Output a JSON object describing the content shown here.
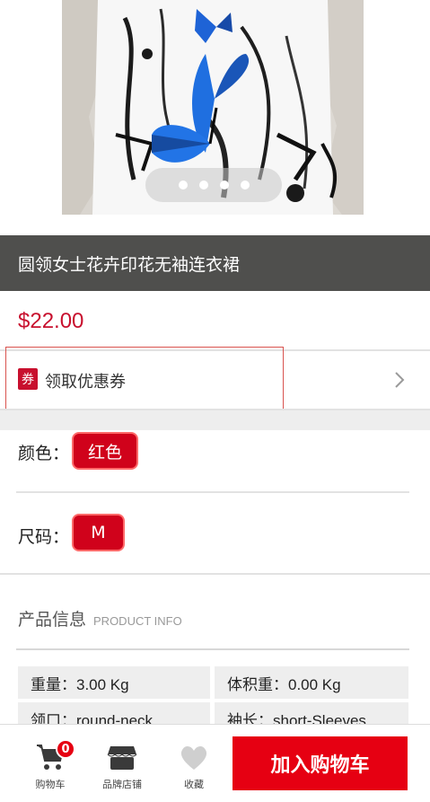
{
  "product": {
    "title": "圆领女士花卉印花无袖连衣裙",
    "price": "$22.00",
    "image_alt": "dress-photo"
  },
  "carousel": {
    "dot_count": 4
  },
  "coupon": {
    "badge": "券",
    "label": "领取优惠券"
  },
  "options": {
    "color_label": "颜色：",
    "color_value": "红色",
    "size_label": "尺码：",
    "size_value": "M"
  },
  "info": {
    "title_zh": "产品信息",
    "title_en": "PRODUCT INFO",
    "specs": [
      {
        "text": "重量：3.00 Kg"
      },
      {
        "text": "体积重：0.00 Kg"
      },
      {
        "text": "领口：round-neck"
      },
      {
        "text": "袖长：short-Sleeves"
      }
    ]
  },
  "bottom_bar": {
    "cart_label": "购物车",
    "cart_count": "0",
    "store_label": "品牌店铺",
    "fav_label": "收藏",
    "add_to_cart": "加入购物车"
  },
  "colors": {
    "accent": "#e60012",
    "price": "#c8102e",
    "title_band": "#4f4f4d"
  },
  "icons": [
    "cart-icon",
    "store-icon",
    "heart-icon",
    "chevron-right-icon"
  ]
}
